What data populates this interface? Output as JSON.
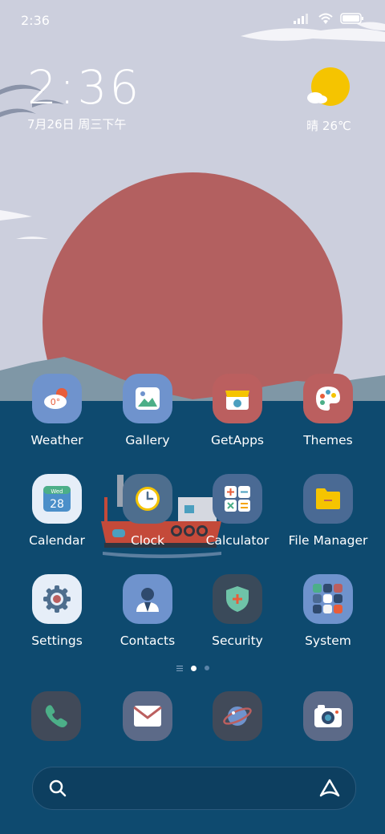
{
  "status_bar": {
    "time": "2:36"
  },
  "clock_widget": {
    "time": "2:36",
    "date": "7月26日 周三下午"
  },
  "weather_widget": {
    "temp": "晴 26℃",
    "icon": "sun-cloud-icon"
  },
  "apps": [
    {
      "label": "Weather",
      "icon": "weather-icon",
      "color": "#6f93cd"
    },
    {
      "label": "Gallery",
      "icon": "gallery-icon",
      "color": "#6f93cd"
    },
    {
      "label": "GetApps",
      "icon": "store-icon",
      "color": "#bb5f5f"
    },
    {
      "label": "Themes",
      "icon": "palette-icon",
      "color": "#bb5f5f"
    },
    {
      "label": "Calendar",
      "icon": "calendar-icon",
      "color": "#e6eef8",
      "cal_day": "Wed",
      "cal_date": "28"
    },
    {
      "label": "Clock",
      "icon": "clock-icon",
      "color": "#4e6e8e"
    },
    {
      "label": "Calculator",
      "icon": "calculator-icon",
      "color": "#4a6a94"
    },
    {
      "label": "File Manager",
      "icon": "folder-icon",
      "color": "#4a6a94"
    },
    {
      "label": "Settings",
      "icon": "gear-icon",
      "color": "#e6eef8"
    },
    {
      "label": "Contacts",
      "icon": "contact-icon",
      "color": "#6f93cd"
    },
    {
      "label": "Security",
      "icon": "shield-icon",
      "color": "#3a4a5a"
    },
    {
      "label": "System",
      "icon": "folder-grid-icon",
      "color": "#6f93cd"
    }
  ],
  "dock": [
    {
      "name": "phone",
      "icon": "phone-icon",
      "color": "#414a59"
    },
    {
      "name": "mail",
      "icon": "mail-icon",
      "color": "#5c6a88"
    },
    {
      "name": "browser",
      "icon": "planet-icon",
      "color": "#414a59"
    },
    {
      "name": "camera",
      "icon": "camera-icon",
      "color": "#5c6a88"
    }
  ],
  "pager": {
    "pages": 2,
    "active": 0
  },
  "search_bar": {
    "search_icon": "search-icon",
    "assistant_icon": "assistant-icon"
  }
}
